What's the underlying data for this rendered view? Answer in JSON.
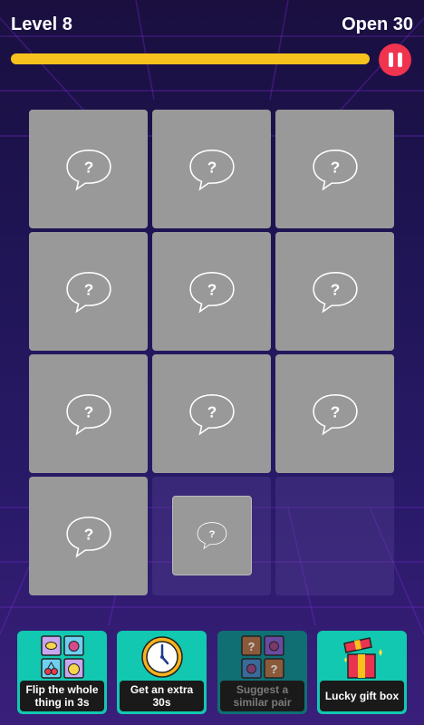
{
  "hud": {
    "level_label": "Level 8",
    "open_label": "Open 30",
    "progress": 1.0
  },
  "colors": {
    "progress_bar": "#f7c21d",
    "pause_button": "#f0334f",
    "card": "#999999",
    "booster_bg": "#12c8b0"
  },
  "board": {
    "rows": 4,
    "cols": 3,
    "cards": [
      {
        "state": "hidden",
        "glyph": "?"
      },
      {
        "state": "hidden",
        "glyph": "?"
      },
      {
        "state": "hidden",
        "glyph": "?"
      },
      {
        "state": "hidden",
        "glyph": "?"
      },
      {
        "state": "hidden",
        "glyph": "?"
      },
      {
        "state": "hidden",
        "glyph": "?"
      },
      {
        "state": "hidden",
        "glyph": "?"
      },
      {
        "state": "hidden",
        "glyph": "?"
      },
      {
        "state": "hidden",
        "glyph": "?"
      },
      {
        "state": "hidden",
        "glyph": "?"
      },
      {
        "state": "appearing",
        "glyph": "?"
      },
      {
        "state": "empty",
        "glyph": ""
      }
    ]
  },
  "boosters": [
    {
      "label": "Flip the whole thing in 3s",
      "icon": "fruit-cards-icon",
      "enabled": true
    },
    {
      "label": "Get an extra 30s",
      "icon": "clock-icon",
      "enabled": true
    },
    {
      "label": "Suggest a similar pair",
      "icon": "hint-cards-icon",
      "enabled": false
    },
    {
      "label": "Lucky gift box",
      "icon": "gift-box-icon",
      "enabled": true
    }
  ]
}
